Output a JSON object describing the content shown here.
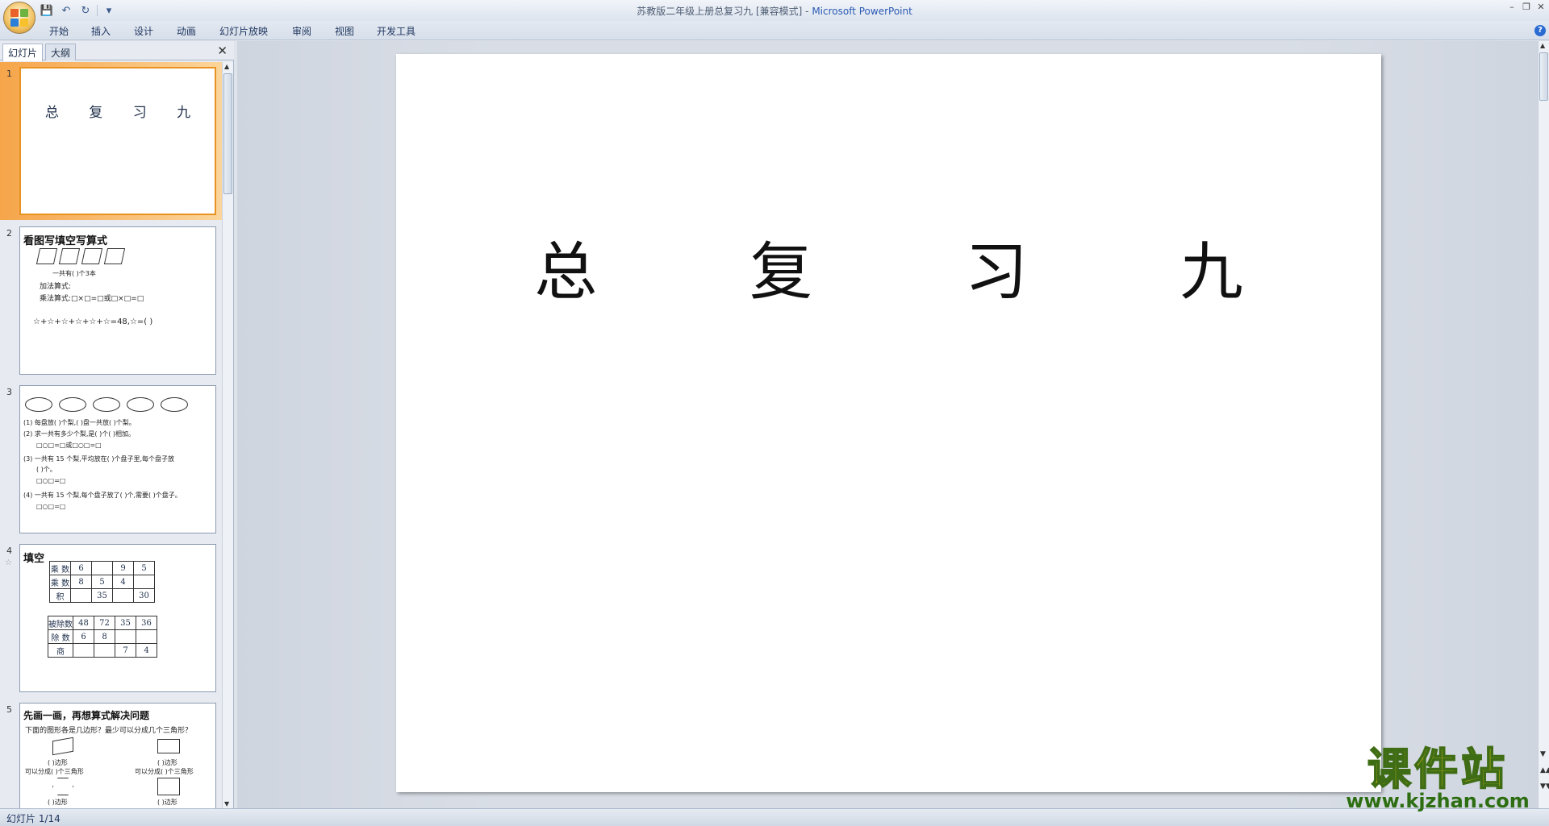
{
  "window": {
    "title": "苏教版二年级上册总复习九 [兼容模式] - ",
    "app": "Microsoft PowerPoint"
  },
  "ribbon": {
    "tabs": [
      "开始",
      "插入",
      "设计",
      "动画",
      "幻灯片放映",
      "审阅",
      "视图",
      "开发工具"
    ]
  },
  "panel": {
    "tabs": [
      "幻灯片",
      "大纲"
    ]
  },
  "thumbs": [
    {
      "num": "1",
      "title": "总 复 习 九"
    },
    {
      "num": "2",
      "title": "看图写填空写算式",
      "lines": [
        "一共有(    )个3本",
        "加法算式:",
        "乘法算式:□×□=□或□×□=□",
        "☆+☆+☆+☆+☆+☆=48,☆=(    )"
      ]
    },
    {
      "num": "3",
      "lines": [
        "(1) 每盘放(    )个梨,(    )盘一共放(    )个梨。",
        "(2) 求一共有多少个梨,是(    )个(    )相加。",
        "□○□=□或□○□=□",
        "(3) 一共有 15 个梨,平均放在(    )个盘子里,每个盘子放",
        "(    )个。",
        "□○□=□",
        "(4) 一共有 15 个梨,每个盘子放了(    )个,需要(    )个盘子。",
        "□○□=□"
      ]
    },
    {
      "num": "4",
      "title": "填空",
      "table1": [
        [
          "乘 数",
          "6",
          "",
          "9",
          "5"
        ],
        [
          "乘 数",
          "8",
          "5",
          "4",
          ""
        ],
        [
          "积",
          "",
          "35",
          "",
          "30"
        ]
      ],
      "table2": [
        [
          "被除数",
          "48",
          "72",
          "35",
          "36"
        ],
        [
          "除 数",
          "6",
          "8",
          "",
          ""
        ],
        [
          "商",
          "",
          "",
          "7",
          "4"
        ]
      ]
    },
    {
      "num": "5",
      "title": "先画一画，再想算式解决问题",
      "lines": [
        "下面的图形各是几边形？最少可以分成几个三角形？",
        "(    )边形",
        "可以分成(    )个三角形",
        "(    )边形",
        "可以分成(    )个三角形",
        "(    )边形",
        "(    )边形"
      ]
    }
  ],
  "slide": {
    "title": "总 复 习 九"
  },
  "status": {
    "slide_info": "幻灯片 1/14"
  },
  "watermark": {
    "main": "课件站",
    "url": "www.kjzhan.com"
  },
  "colors": {
    "accent": "#f6a54a",
    "watermark_fill": "#f2d10a",
    "watermark_green": "#2e6e12"
  }
}
